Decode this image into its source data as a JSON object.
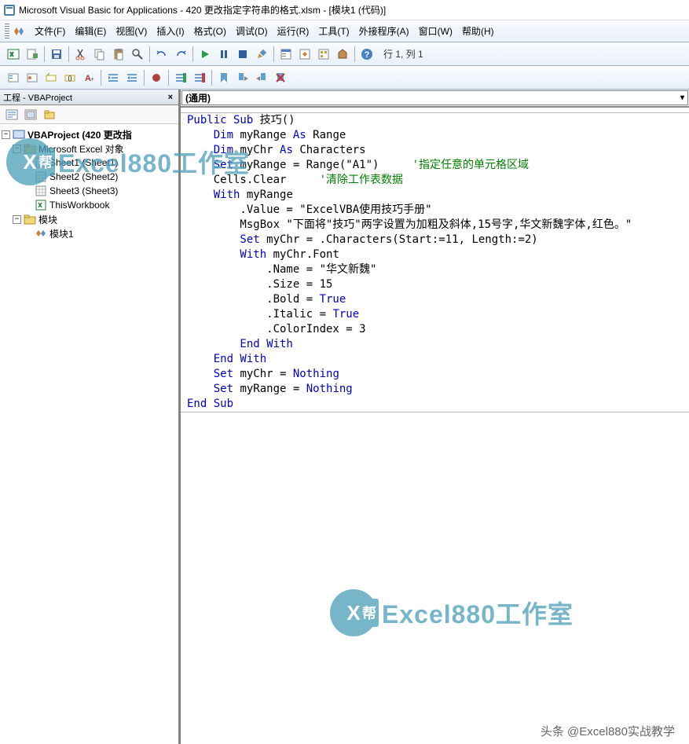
{
  "titlebar": {
    "text": "Microsoft Visual Basic for Applications - 420 更改指定字符串的格式.xlsm - [模块1 (代码)]"
  },
  "menu": {
    "file": "文件(F)",
    "edit": "编辑(E)",
    "view": "视图(V)",
    "insert": "插入(I)",
    "format": "格式(O)",
    "debug": "调试(D)",
    "run": "运行(R)",
    "tools": "工具(T)",
    "addins": "外接程序(A)",
    "window": "窗口(W)",
    "help": "帮助(H)"
  },
  "toolbar": {
    "status": "行 1, 列 1"
  },
  "project": {
    "title": "工程 - VBAProject",
    "root": "VBAProject (420 更改指",
    "excelObjects": "Microsoft Excel 对象",
    "sheet1": "Sheet1 (Sheet1)",
    "sheet2": "Sheet2 (Sheet2)",
    "sheet3": "Sheet3 (Sheet3)",
    "thisWorkbook": "ThisWorkbook",
    "modules": "模块",
    "module1": "模块1"
  },
  "codeDropdown": {
    "left": "(通用)"
  },
  "code": {
    "l1a": "Public Sub",
    "l1b": " 技巧()",
    "l2a": "    Dim",
    "l2b": " myRange ",
    "l2c": "As",
    "l2d": " Range",
    "l3a": "    Dim",
    "l3b": " myChr ",
    "l3c": "As",
    "l3d": " Characters",
    "l4a": "    Set",
    "l4b": " myRange = Range(\"A1\")     ",
    "l4c": "'指定任意的单元格区域",
    "l5a": "    Cells.Clear     ",
    "l5b": "'清除工作表数据",
    "l6a": "    With",
    "l6b": " myRange",
    "l7": "        .Value = \"ExcelVBA使用技巧手册\"",
    "l8": "        MsgBox \"下面将\"技巧\"两字设置为加粗及斜体,15号字,华文新魏字体,红色。\"",
    "l9a": "        Set",
    "l9b": " myChr = .Characters(Start:=11, Length:=2)",
    "l10a": "        With",
    "l10b": " myChr.Font",
    "l11": "            .Name = \"华文新魏\"",
    "l12": "            .Size = 15",
    "l13a": "            .Bold = ",
    "l13b": "True",
    "l14a": "            .Italic = ",
    "l14b": "True",
    "l15": "            .ColorIndex = 3",
    "l16": "        End With",
    "l17": "    End With",
    "l18a": "    Set",
    "l18b": " myChr = ",
    "l18c": "Nothing",
    "l19a": "    Set",
    "l19b": " myRange = ",
    "l19c": "Nothing",
    "l20": "End Sub"
  },
  "watermark": {
    "iconLeft": "X",
    "iconRight": "帮",
    "text": "Excel880工作室"
  },
  "footer": {
    "credit": "头条 @Excel880实战教学"
  }
}
